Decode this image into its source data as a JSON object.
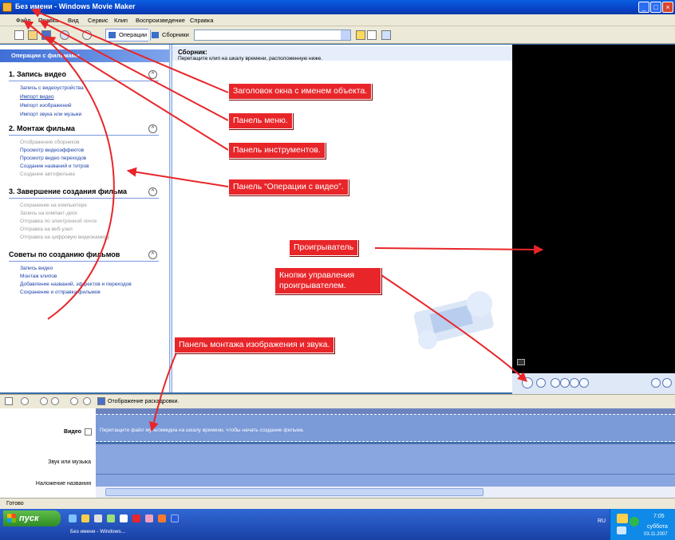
{
  "window": {
    "title": "Без имени - Windows Movie Maker"
  },
  "menu": [
    "Файл",
    "Правка",
    "Вид",
    "Сервис",
    "Клип",
    "Воспроизведение",
    "Справка"
  ],
  "toolbar": {
    "tasks_label": "Операции",
    "collections_label": "Сборники"
  },
  "task_pane": {
    "title": "Операции с фильмами",
    "sections": [
      {
        "heading": "1. Запись видео",
        "items": [
          "Запись с видеоустройства",
          "Импорт видео",
          "Импорт изображений",
          "Импорт звука или музыки"
        ]
      },
      {
        "heading": "2. Монтаж фильма",
        "items": [
          "Отображение сборников",
          "Просмотр видеоэффектов",
          "Просмотр видео переходов",
          "Создание названий и титров",
          "Создание автофильма"
        ]
      },
      {
        "heading": "3. Завершение создания фильма",
        "items": [
          "Сохранение на компьютере",
          "Запись на компакт-диск",
          "Отправка по электронной почте",
          "Отправка на веб-узел",
          "Отправка на цифровую видеокамеру"
        ]
      },
      {
        "heading": "Советы по созданию фильмов",
        "items": [
          "Запись видео",
          "Монтаж клипов",
          "Добавление названий, эффектов и переходов",
          "Сохранение и отправка фильмов"
        ]
      }
    ]
  },
  "collection": {
    "title": "Сборник:",
    "hint": "Перетащите клип на шкалу времени, расположенную ниже."
  },
  "timeline": {
    "toggle_label": "Отображение раскадровки.",
    "tracks": [
      "Видео",
      "Звук или музыка",
      "Наложение названия"
    ],
    "video_hint": "Перетащите файл мультимедиа на шкалу времени, чтобы начать создание фильма."
  },
  "status": "Готово",
  "taskbar": {
    "start": "пуск",
    "task": "Без имени - Windows...",
    "lang": "RU",
    "time": "7:05",
    "day": "суббота",
    "date": "03.11.2007"
  },
  "annotations": [
    "Заголовок окна с именем объекта.",
    "Панель меню.",
    "Панель инструментов.",
    "Панель “Операции с видео”.",
    "Проигрыватель",
    "Кнопки управления проигрывателем.",
    "Панель монтажа изображения и звука."
  ],
  "colors": {
    "callout": "#e8262a",
    "player": "#000000",
    "track": "#7a9ad8"
  }
}
